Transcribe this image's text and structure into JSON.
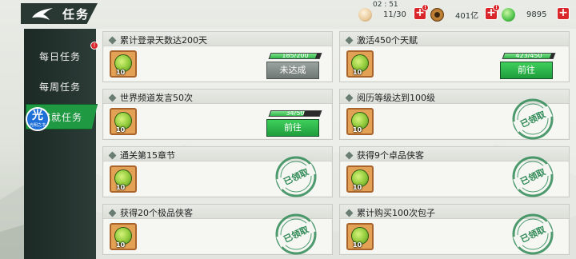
{
  "header": {
    "title": "任务",
    "timer": "02 : 51"
  },
  "resources": [
    {
      "name": "bun",
      "icon": "bun-icon",
      "value": "11/30",
      "color": "#e8c89a"
    },
    {
      "name": "coin",
      "icon": "copper-coin-icon",
      "value": "401亿",
      "color": "#c8893a"
    },
    {
      "name": "jade",
      "icon": "jade-icon",
      "value": "9895",
      "color": "#4ec24a"
    }
  ],
  "sidebar": {
    "items": [
      {
        "label": "每日任务",
        "badge": "!"
      },
      {
        "label": "每周任务",
        "badge": ""
      },
      {
        "label": "成就任务",
        "badge": ""
      }
    ],
    "vip": {
      "main": "光",
      "sub": "光明之书"
    }
  },
  "tasks": [
    {
      "title": "累计登录天数达200天",
      "reward_count": "10",
      "progress": "185/200",
      "progress_fraction": 0.925,
      "button": "未达成",
      "state": "pending"
    },
    {
      "title": "激活450个天赋",
      "reward_count": "10",
      "progress": "423/450",
      "progress_fraction": 0.94,
      "button": "前往",
      "state": "go"
    },
    {
      "title": "世界频道发言50次",
      "reward_count": "10",
      "progress": "34/50",
      "progress_fraction": 0.68,
      "button": "前往",
      "state": "go"
    },
    {
      "title": "阅历等级达到100级",
      "reward_count": "10",
      "progress": "",
      "button": "",
      "state": "claimed",
      "stamp": "已领取"
    },
    {
      "title": "通关第15章节",
      "reward_count": "10",
      "progress": "",
      "button": "",
      "state": "claimed",
      "stamp": "已领取"
    },
    {
      "title": "获得9个卓品侠客",
      "reward_count": "10",
      "progress": "",
      "button": "",
      "state": "claimed",
      "stamp": "已领取"
    },
    {
      "title": "获得20个极品侠客",
      "reward_count": "10",
      "progress": "",
      "button": "",
      "state": "claimed",
      "stamp": "已领取"
    },
    {
      "title": "累计购买100次包子",
      "reward_count": "10",
      "progress": "",
      "button": "",
      "state": "claimed",
      "stamp": "已领取"
    }
  ],
  "colors": {
    "accent_green": "#1f9a43",
    "stamp_green": "#2e8a55",
    "sidebar_dark": "#1c2925",
    "alert_red": "#d8262a"
  }
}
